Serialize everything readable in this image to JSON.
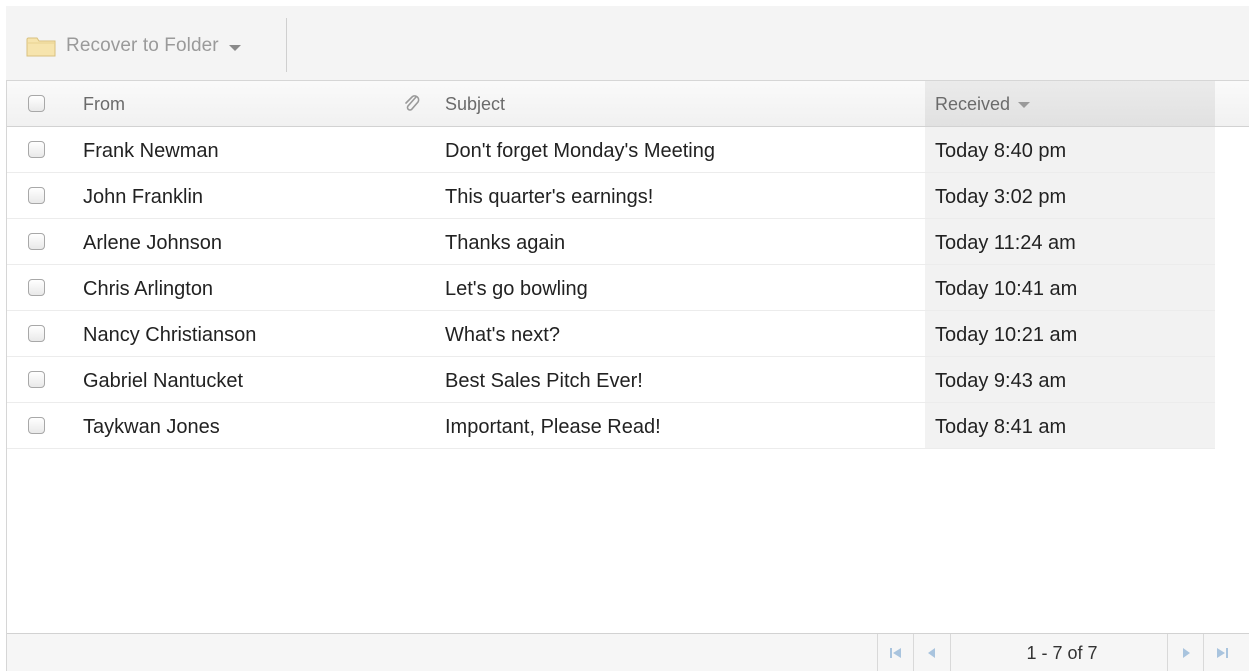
{
  "toolbar": {
    "recover_label": "Recover to Folder",
    "icon": "folder-icon"
  },
  "columns": {
    "from": "From",
    "attachment_icon": "paperclip-icon",
    "subject": "Subject",
    "received": "Received"
  },
  "rows": [
    {
      "from": "Frank Newman",
      "subject": "Don't forget Monday's Meeting",
      "received": "Today 8:40 pm"
    },
    {
      "from": "John Franklin",
      "subject": "This quarter's earnings!",
      "received": "Today 3:02 pm"
    },
    {
      "from": "Arlene Johnson",
      "subject": "Thanks again",
      "received": "Today 11:24 am"
    },
    {
      "from": "Chris Arlington",
      "subject": "Let's go bowling",
      "received": "Today 10:41 am"
    },
    {
      "from": "Nancy Christianson",
      "subject": "What's next?",
      "received": "Today 10:21 am"
    },
    {
      "from": "Gabriel Nantucket",
      "subject": "Best Sales Pitch Ever!",
      "received": "Today 9:43 am"
    },
    {
      "from": "Taykwan Jones",
      "subject": "Important, Please Read!",
      "received": "Today 8:41 am"
    }
  ],
  "pager": {
    "info": "1 - 7 of 7"
  },
  "colors": {
    "pager_icon": "#a9c4de",
    "header_sorted": "#e6e6e6",
    "folder": "#f3dfa3"
  }
}
